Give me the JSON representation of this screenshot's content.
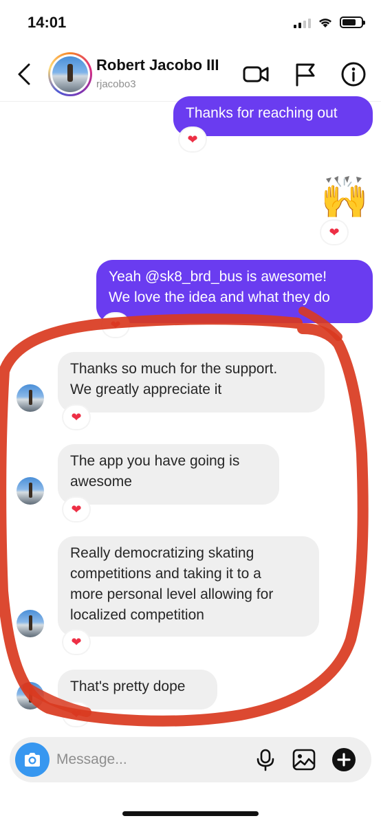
{
  "status_bar": {
    "time": "14:01"
  },
  "header": {
    "name": "Robert Jacobo III",
    "username": "rjacobo3"
  },
  "messages": [
    {
      "from": "me",
      "text_lines": [
        "Thanks for reaching out"
      ],
      "reaction": "heart"
    },
    {
      "from": "me",
      "text_lines": [
        "🙌"
      ],
      "reaction": "heart"
    },
    {
      "from": "me",
      "text_lines": [
        "Yeah @sk8_brd_bus is awesome!",
        "We love the idea and what they do"
      ],
      "reaction": "heart"
    },
    {
      "from": "them",
      "text_lines": [
        "Thanks so much for the support.",
        "We greatly appreciate it"
      ],
      "reaction": "heart"
    },
    {
      "from": "them",
      "text_lines": [
        "The app you have going is",
        "awesome"
      ],
      "reaction": "heart"
    },
    {
      "from": "them",
      "text_lines": [
        "Really democratizing skating",
        "competitions and taking it to a",
        "more personal level allowing for",
        "localized competition"
      ],
      "reaction": "heart"
    },
    {
      "from": "them",
      "text_lines": [
        "That's pretty dope"
      ],
      "reaction": "heart"
    }
  ],
  "composer": {
    "placeholder": "Message...",
    "icons": [
      "camera-icon",
      "microphone-icon",
      "gallery-icon",
      "plus-icon"
    ]
  },
  "colors": {
    "sent_bubble": "#6a3cf0",
    "received_bubble": "#efefef",
    "reaction_heart": "#ed2f45",
    "annotation_circle": "#d93a20",
    "camera_button": "#3797f0"
  },
  "icons": {
    "reaction": "heart-icon",
    "header": [
      "chevron-left-icon",
      "video-camera-icon",
      "flag-icon",
      "info-icon"
    ]
  }
}
